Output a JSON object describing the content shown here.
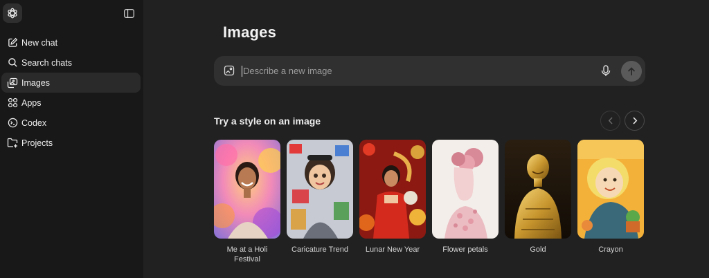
{
  "sidebar": {
    "items": [
      {
        "label": "New chat",
        "icon": "new-chat-icon"
      },
      {
        "label": "Search chats",
        "icon": "search-icon"
      },
      {
        "label": "Images",
        "icon": "images-icon",
        "active": true
      },
      {
        "label": "Apps",
        "icon": "apps-grid-icon"
      },
      {
        "label": "Codex",
        "icon": "codex-icon"
      },
      {
        "label": "Projects",
        "icon": "folder-plus-icon"
      }
    ]
  },
  "main": {
    "title": "Images",
    "prompt": {
      "placeholder": "Describe a new image",
      "value": ""
    },
    "styles_title": "Try a style on an image",
    "styles": [
      {
        "label": "Me at a Holi Festival"
      },
      {
        "label": "Caricature Trend"
      },
      {
        "label": "Lunar New Year"
      },
      {
        "label": "Flower petals"
      },
      {
        "label": "Gold"
      },
      {
        "label": "Crayon"
      }
    ]
  },
  "colors": {
    "sidebar_bg": "#181818",
    "main_bg": "#212121",
    "input_bg": "#303030",
    "active_item_bg": "#2a2a2a",
    "send_button_bg": "#5a5a5a"
  }
}
